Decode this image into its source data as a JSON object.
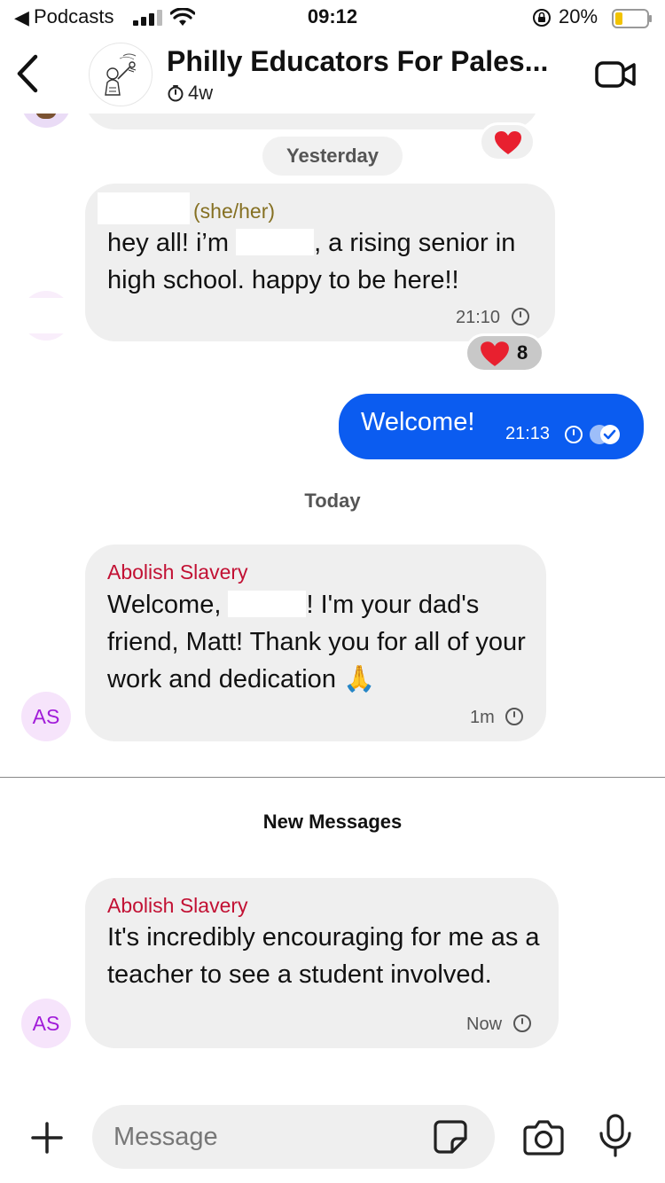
{
  "status_bar": {
    "back_app": "Podcasts",
    "time": "09:12",
    "battery_pct": "20%"
  },
  "header": {
    "title": "Philly Educators For Pales...",
    "subtitle": "4w"
  },
  "dates": {
    "yesterday": "Yesterday",
    "today": "Today",
    "new_messages": "New Messages"
  },
  "messages": [
    {
      "pronouns": "(she/her)",
      "text_part1": "hey all! i’m",
      "text_part2": ", a rising senior in high school. happy to be here!!",
      "time": "21:10",
      "reaction_count": "8"
    },
    {
      "text": "Welcome!",
      "time": "21:13"
    },
    {
      "sender": "Abolish Slavery",
      "text_part1": "Welcome,",
      "text_part2": "! I'm your dad's friend, Matt! Thank you for all of your work and dedication 🙏",
      "time": "1m",
      "avatar": "AS"
    },
    {
      "sender": "Abolish Slavery",
      "text": "It's incredibly encouraging for me as a teacher to see a student involved.",
      "time": "Now",
      "avatar": "AS"
    }
  ],
  "composer": {
    "placeholder": "Message"
  },
  "icons": {
    "reaction": "heart-icon",
    "timer": "timer-icon",
    "seen": "double-check-icon"
  },
  "colors": {
    "outgoing_bubble": "#0b5cf0",
    "incoming_bubble": "#efefef",
    "sender_name": "#c21033",
    "pronouns": "#857022",
    "avatar_text": "#a11bd9",
    "heart": "#e8202f"
  }
}
